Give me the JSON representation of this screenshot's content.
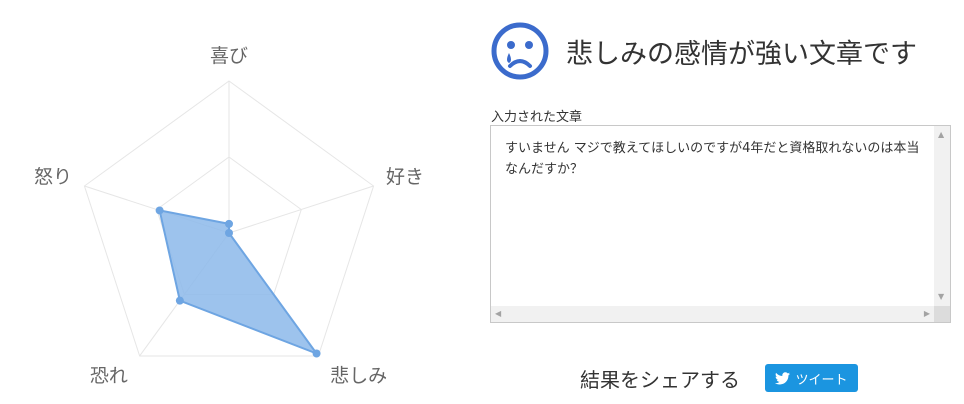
{
  "chart_data": {
    "type": "radar",
    "axes": [
      "喜び",
      "好き",
      "悲しみ",
      "恐れ",
      "怒り"
    ],
    "values": [
      0.06,
      0.0,
      0.98,
      0.55,
      0.48
    ],
    "range": [
      0,
      1
    ],
    "gridlines": true,
    "fill_color": "#8cb8ea",
    "line_color": "#6ea5e2"
  },
  "result": {
    "title": "悲しみの感情が強い文章です",
    "emoji_icon": "sad-face-icon",
    "accent_color": "#3b6bcc"
  },
  "input": {
    "label": "入力された文章",
    "text": "すいません マジで教えてほしいのですが4年だと資格取れないのは本当なんだすか？"
  },
  "share": {
    "label": "結果をシェアする",
    "tweet_label": "ツイート",
    "tweet_icon": "twitter-bird-icon",
    "button_color": "#1b95e0"
  }
}
